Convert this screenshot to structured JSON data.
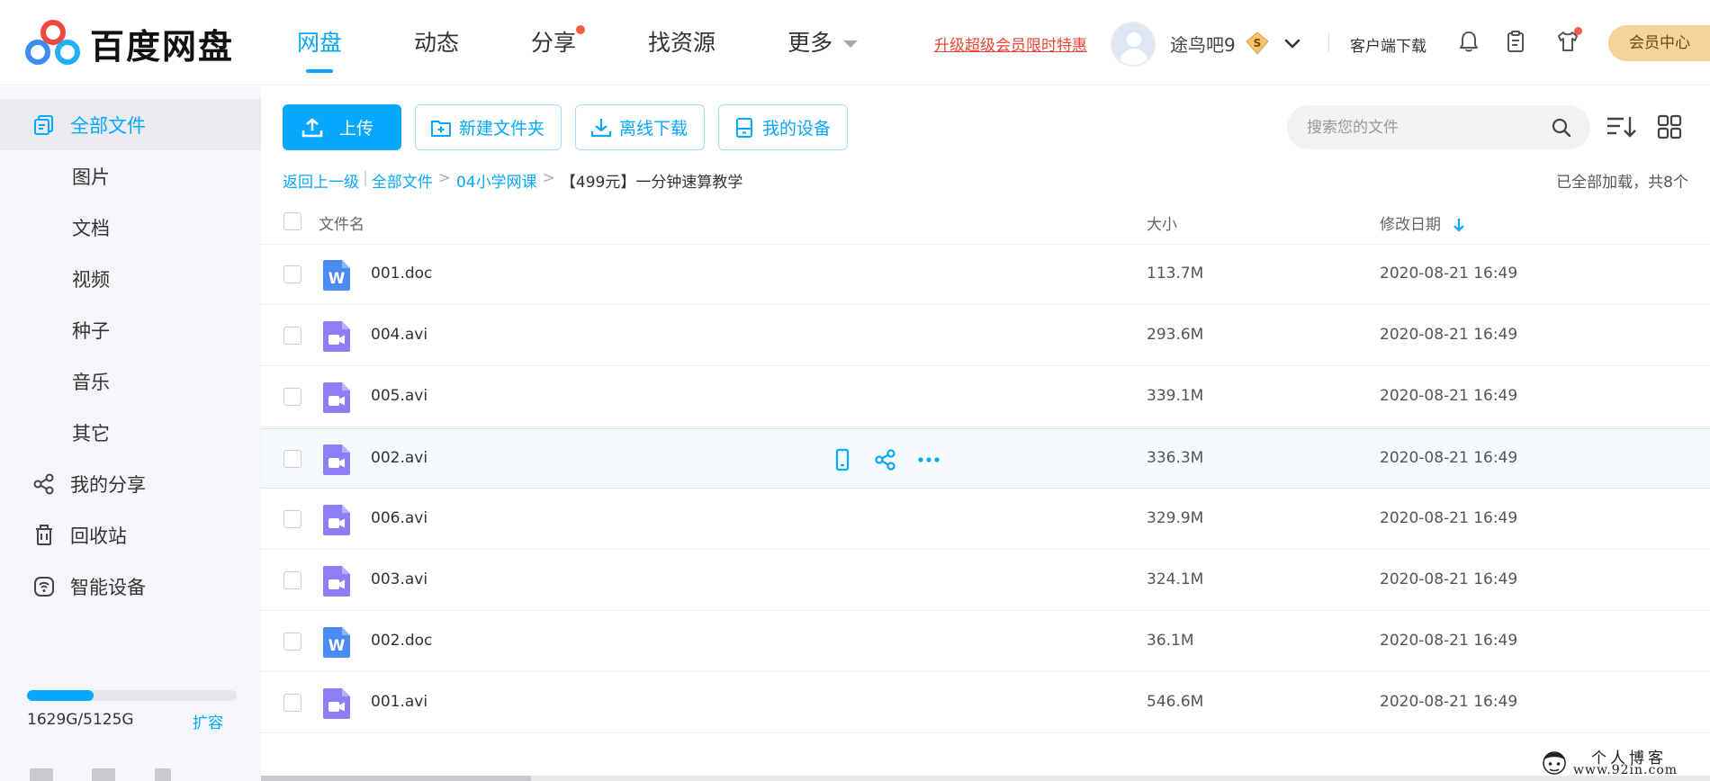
{
  "app": {
    "logo_text": "百度网盘"
  },
  "nav": {
    "items": [
      {
        "label": "网盘",
        "active": true
      },
      {
        "label": "动态"
      },
      {
        "label": "分享",
        "dot": true
      },
      {
        "label": "找资源"
      },
      {
        "label": "更多",
        "caret": true
      }
    ]
  },
  "header": {
    "promo": "升级超级会员限时特惠",
    "username": "途鸟吧9",
    "vip_symbol": "S",
    "client_download": "客户端下载",
    "vip_center": "会员中心"
  },
  "sidebar": {
    "items": [
      {
        "label": "全部文件",
        "active": true
      },
      {
        "label": "图片"
      },
      {
        "label": "文档"
      },
      {
        "label": "视频"
      },
      {
        "label": "种子"
      },
      {
        "label": "音乐"
      },
      {
        "label": "其它"
      },
      {
        "label": "我的分享"
      },
      {
        "label": "回收站"
      },
      {
        "label": "智能设备"
      }
    ],
    "quota_text": "1629G/5125G",
    "quota_fraction": 0.318,
    "expand_label": "扩容"
  },
  "toolbar": {
    "upload": "上传",
    "new_folder": "新建文件夹",
    "offline_download": "离线下载",
    "my_devices": "我的设备"
  },
  "search": {
    "placeholder": "搜索您的文件"
  },
  "breadcrumb": {
    "back": "返回上一级",
    "all_files": "全部文件",
    "level1": "04小学网课",
    "current": "【499元】一分钟速算教学",
    "loaded_status": "已全部加载，共8个"
  },
  "table": {
    "columns": {
      "name": "文件名",
      "size": "大小",
      "modified": "修改日期"
    },
    "rows": [
      {
        "name": "001.doc",
        "type": "word",
        "size": "113.7M",
        "date": "2020-08-21 16:49"
      },
      {
        "name": "004.avi",
        "type": "video",
        "size": "293.6M",
        "date": "2020-08-21 16:49"
      },
      {
        "name": "005.avi",
        "type": "video",
        "size": "339.1M",
        "date": "2020-08-21 16:49"
      },
      {
        "name": "002.avi",
        "type": "video",
        "size": "336.3M",
        "date": "2020-08-21 16:49",
        "hover": true
      },
      {
        "name": "006.avi",
        "type": "video",
        "size": "329.9M",
        "date": "2020-08-21 16:49"
      },
      {
        "name": "003.avi",
        "type": "video",
        "size": "324.1M",
        "date": "2020-08-21 16:49"
      },
      {
        "name": "002.doc",
        "type": "word",
        "size": "36.1M",
        "date": "2020-08-21 16:49"
      },
      {
        "name": "001.avi",
        "type": "video",
        "size": "546.6M",
        "date": "2020-08-21 16:49"
      }
    ],
    "word_icon_letter": "W"
  },
  "watermark": {
    "line1": "个人博客",
    "line2": "www.92in.com"
  },
  "colors": {
    "accent": "#06a7ff",
    "promo_red": "#ee4433",
    "video_icon": "#8c7ff5",
    "word_icon": "#4a8bf5",
    "vip_gold": "#f5d49a"
  }
}
